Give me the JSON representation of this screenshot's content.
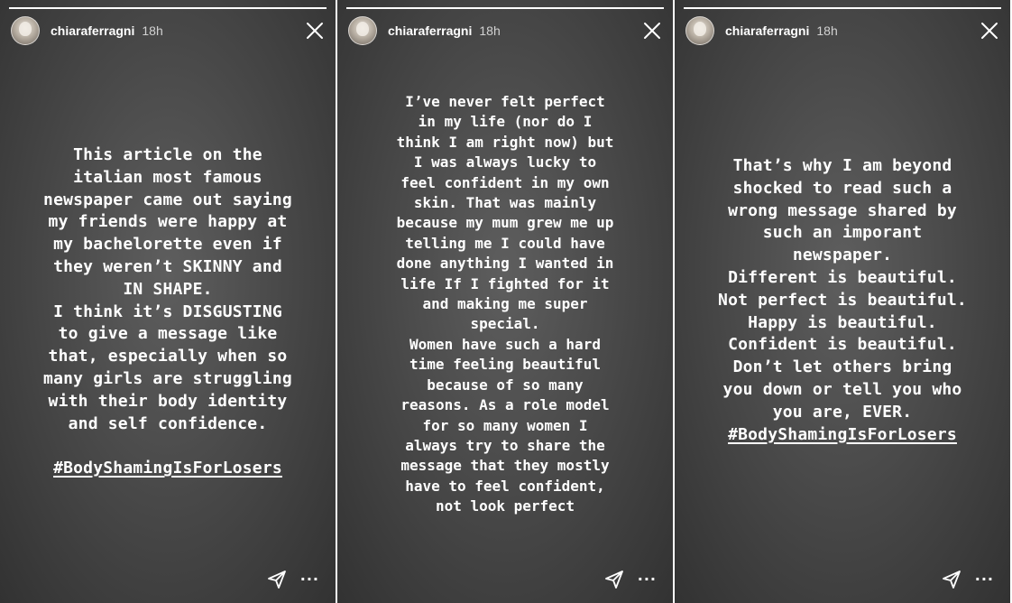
{
  "stories": [
    {
      "username": "chiaraferragni",
      "time": "18h",
      "text_lines": [
        "This article on the",
        "italian most famous",
        "newspaper came out saying",
        "my friends were happy at",
        "my bachelorette even if",
        "they weren’t SKINNY and",
        "IN SHAPE.",
        "I think it’s DISGUSTING",
        "to give a message like",
        "that, especially when so",
        "many girls are struggling",
        "with their body identity",
        "and self confidence."
      ],
      "hashtag": "#BodyShamingIsForLosers"
    },
    {
      "username": "chiaraferragni",
      "time": "18h",
      "text_lines": [
        "I’ve never felt perfect",
        "in my life (nor do I",
        "think I am right now) but",
        "I was always lucky to",
        "feel confident in my own",
        "skin. That was mainly",
        "because my mum grew me up",
        "telling me I could have",
        "done anything I wanted in",
        "life If I fighted for it",
        "and making me super",
        "special.",
        "Women have such a hard",
        "time feeling beautiful",
        "because of so many",
        "reasons. As a role model",
        "for so many women I",
        "always try to share the",
        "message that they mostly",
        "have to feel confident,",
        "not look perfect"
      ]
    },
    {
      "username": "chiaraferragni",
      "time": "18h",
      "text_lines": [
        "That’s why I am beyond",
        "shocked to read such a",
        "wrong message shared by",
        "such an imporant",
        "newspaper.",
        "Different is beautiful.",
        "Not perfect is beautiful.",
        "Happy is beautiful.",
        "Confident is beautiful.",
        "Don’t let others bring",
        "you down or tell you who",
        "you are, EVER."
      ],
      "hashtag": "#BodyShamingIsForLosers"
    }
  ],
  "icons": {
    "close": "close-icon",
    "send": "paper-plane-send-icon",
    "more": "more-options-icon"
  },
  "more_glyph": "···",
  "progress": [
    1.0,
    1.0,
    1.0
  ]
}
